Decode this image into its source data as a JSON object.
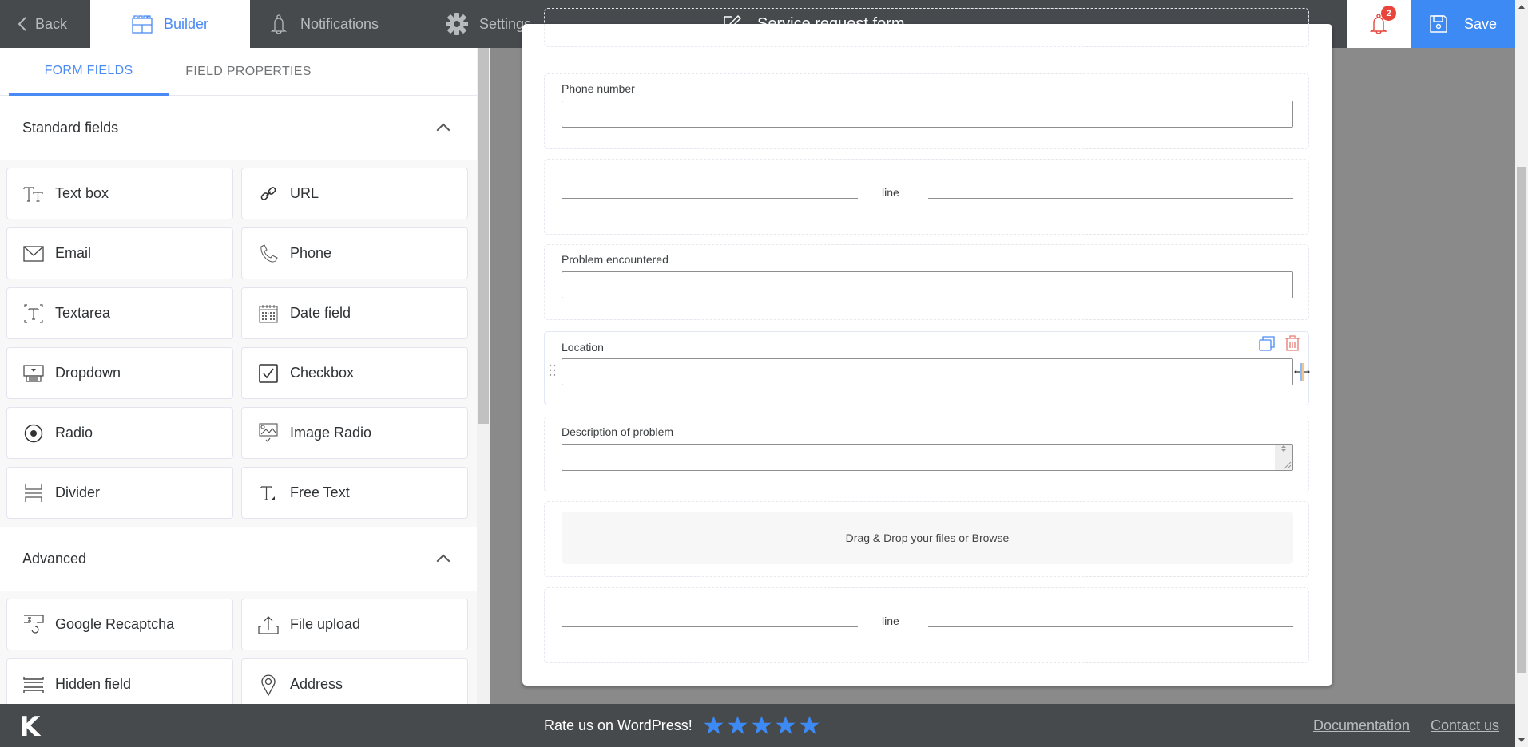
{
  "header": {
    "back_label": "Back",
    "tabs": [
      {
        "label": "Builder",
        "icon": "blocks-icon",
        "active": true
      },
      {
        "label": "Notifications",
        "icon": "bell-icon",
        "active": false
      },
      {
        "label": "Settings",
        "icon": "gear-icon",
        "active": false
      }
    ],
    "form_title": "Service request form",
    "notification_count": "2",
    "save_label": "Save",
    "accent_color": "#3d8af5",
    "alert_color": "#e8453c"
  },
  "left_panel": {
    "tabs": [
      {
        "label": "FORM FIELDS",
        "active": true
      },
      {
        "label": "FIELD PROPERTIES",
        "active": false
      }
    ],
    "sections": [
      {
        "title": "Standard fields",
        "expanded": true,
        "items": [
          {
            "label": "Text box",
            "icon": "text-size-icon"
          },
          {
            "label": "URL",
            "icon": "link-icon"
          },
          {
            "label": "Email",
            "icon": "envelope-icon"
          },
          {
            "label": "Phone",
            "icon": "phone-icon"
          },
          {
            "label": "Textarea",
            "icon": "textarea-icon"
          },
          {
            "label": "Date field",
            "icon": "calendar-icon"
          },
          {
            "label": "Dropdown",
            "icon": "dropdown-icon"
          },
          {
            "label": "Checkbox",
            "icon": "checkbox-icon"
          },
          {
            "label": "Radio",
            "icon": "radio-icon"
          },
          {
            "label": "Image Radio",
            "icon": "image-radio-icon"
          },
          {
            "label": "Divider",
            "icon": "divider-icon"
          },
          {
            "label": "Free Text",
            "icon": "free-text-icon"
          }
        ]
      },
      {
        "title": "Advanced",
        "expanded": true,
        "items": [
          {
            "label": "Google Recaptcha",
            "icon": "recaptcha-icon"
          },
          {
            "label": "File upload",
            "icon": "upload-icon"
          },
          {
            "label": "Hidden field",
            "icon": "hidden-field-icon"
          },
          {
            "label": "Address",
            "icon": "map-pin-icon"
          }
        ]
      }
    ]
  },
  "form": {
    "fields": [
      {
        "type": "text",
        "label": "Phone number",
        "value": ""
      },
      {
        "type": "divider",
        "text": "line"
      },
      {
        "type": "text",
        "label": "Problem encountered",
        "value": ""
      },
      {
        "type": "text",
        "label": "Location",
        "value": "",
        "selected": true
      },
      {
        "type": "textarea",
        "label": "Description of problem",
        "value": ""
      },
      {
        "type": "file",
        "text": "Drag & Drop your files or Browse"
      },
      {
        "type": "divider",
        "text": "line"
      }
    ]
  },
  "footer": {
    "logo": "K",
    "rate_text": "Rate us on WordPress!",
    "stars": 5,
    "links": [
      "Documentation",
      "Contact us"
    ]
  }
}
